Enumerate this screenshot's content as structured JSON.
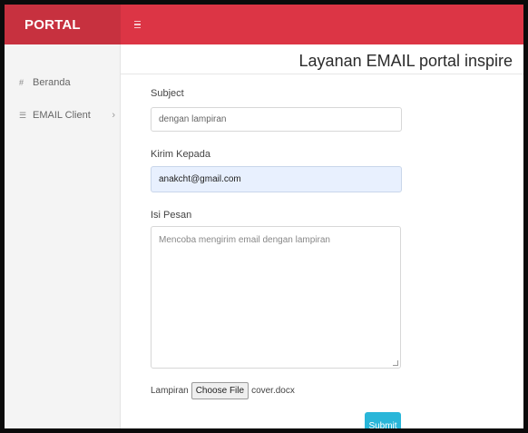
{
  "header": {
    "brand": "PORTAL",
    "menu_icon": "hamburger-icon",
    "colors": {
      "bar": "#dc3545",
      "brand_bg": "#c7313f"
    }
  },
  "sidebar": {
    "items": [
      {
        "label": "Beranda",
        "icon": "home-icon"
      },
      {
        "label": "EMAIL Client",
        "icon": "list-icon",
        "chevron": "›"
      }
    ]
  },
  "main": {
    "title": "Layanan EMAIL portal inspire",
    "form": {
      "subject_label": "Subject",
      "subject_value": "dengan lampiran",
      "to_label": "Kirim Kepada",
      "to_value": "anakcht@gmail.com",
      "message_label": "Isi Pesan",
      "message_value": "Mencoba mengirim email dengan lampiran",
      "attachment_label": "Lampiran",
      "choose_file_label": "Choose File",
      "file_name": "cover.docx",
      "submit_label": "Submit"
    },
    "colors": {
      "submit": "#29b6d9",
      "autofill": "#e8f0fe"
    }
  }
}
